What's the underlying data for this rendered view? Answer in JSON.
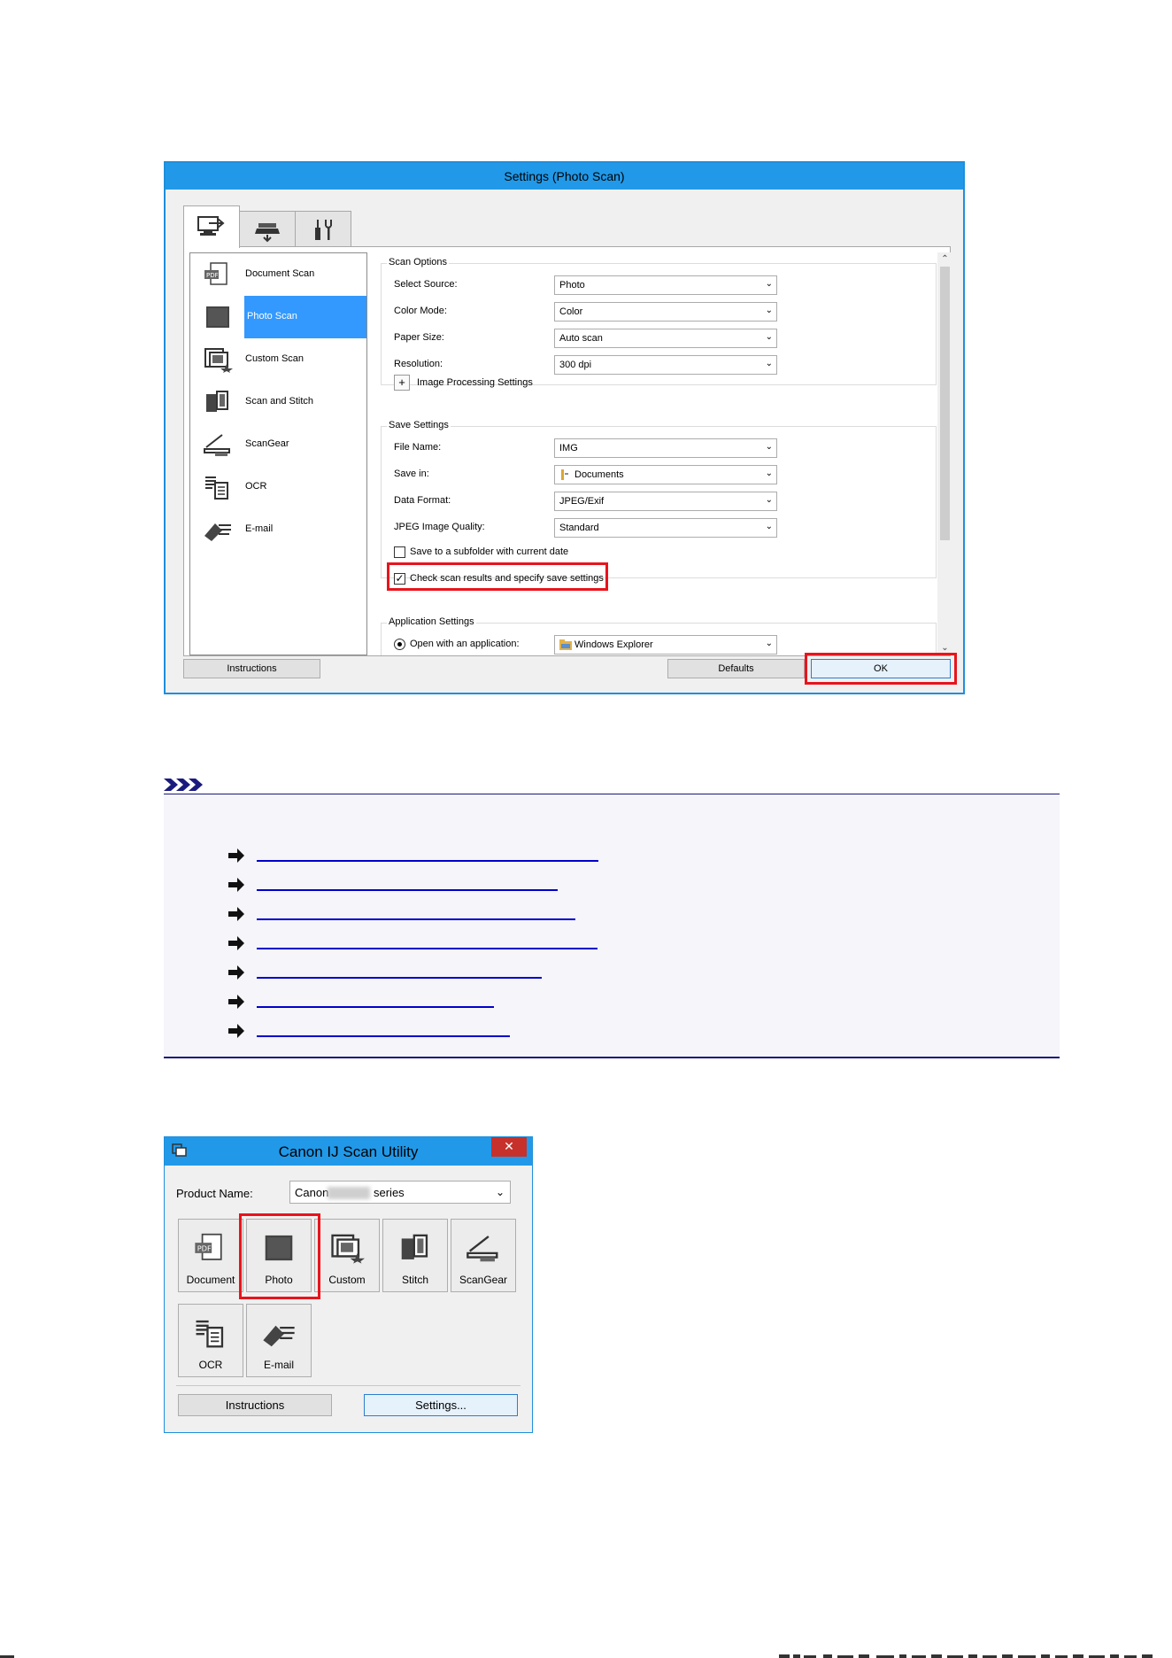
{
  "settings_dialog": {
    "title": "Settings (Photo Scan)",
    "tabs": [
      {
        "icon": "scan-from-computer-icon"
      },
      {
        "icon": "scan-from-operation-panel-icon"
      },
      {
        "icon": "general-settings-icon"
      }
    ],
    "left_list": [
      {
        "label": "Document Scan",
        "icon": "pdf-document-icon"
      },
      {
        "label": "Photo Scan",
        "icon": "photo-icon",
        "selected": true
      },
      {
        "label": "Custom Scan",
        "icon": "custom-scan-icon"
      },
      {
        "label": "Scan and Stitch",
        "icon": "stitch-icon"
      },
      {
        "label": "ScanGear",
        "icon": "scangear-icon"
      },
      {
        "label": "OCR",
        "icon": "ocr-icon"
      },
      {
        "label": "E-mail",
        "icon": "email-icon"
      }
    ],
    "scan_options": {
      "title": "Scan Options",
      "select_source_label": "Select Source:",
      "select_source_value": "Photo",
      "color_mode_label": "Color Mode:",
      "color_mode_value": "Color",
      "paper_size_label": "Paper Size:",
      "paper_size_value": "Auto scan",
      "resolution_label": "Resolution:",
      "resolution_value": "300 dpi",
      "image_processing_expand": "+",
      "image_processing_label": "Image Processing Settings"
    },
    "save_settings": {
      "title": "Save Settings",
      "file_name_label": "File Name:",
      "file_name_value": "IMG",
      "save_in_label": "Save in:",
      "save_in_value": "Documents",
      "data_format_label": "Data Format:",
      "data_format_value": "JPEG/Exif",
      "jpeg_quality_label": "JPEG Image Quality:",
      "jpeg_quality_value": "Standard",
      "subfolder_label": "Save to a subfolder with current date",
      "subfolder_checked": false,
      "check_results_label": "Check scan results and specify save settings",
      "check_results_checked": true,
      "check_mark": "✓"
    },
    "application_settings": {
      "title": "Application Settings",
      "open_with_label": "Open with an application:",
      "open_with_value": "Windows Explorer"
    },
    "buttons": {
      "instructions": "Instructions",
      "defaults": "Defaults",
      "ok": "OK"
    },
    "highlight_color": "#e8141c"
  },
  "note": {
    "accent_color": "#1a1a7e",
    "link_count": 7
  },
  "scan_utility": {
    "title": "Canon IJ Scan Utility",
    "close_glyph": "✕",
    "product_name_label": "Product Name:",
    "product_name_prefix": "Canon",
    "product_name_suffix": "series",
    "tiles": [
      {
        "label": "Document",
        "icon": "pdf-document-icon"
      },
      {
        "label": "Photo",
        "icon": "photo-icon",
        "highlighted": true
      },
      {
        "label": "Custom",
        "icon": "custom-scan-icon"
      },
      {
        "label": "Stitch",
        "icon": "stitch-icon"
      },
      {
        "label": "ScanGear",
        "icon": "scangear-icon"
      },
      {
        "label": "OCR",
        "icon": "ocr-icon"
      },
      {
        "label": "E-mail",
        "icon": "email-icon"
      }
    ],
    "buttons": {
      "instructions": "Instructions",
      "settings": "Settings..."
    }
  },
  "chevron_glyph": "⌄",
  "scroll_up_glyph": "⌃",
  "scroll_down_glyph": "⌄"
}
